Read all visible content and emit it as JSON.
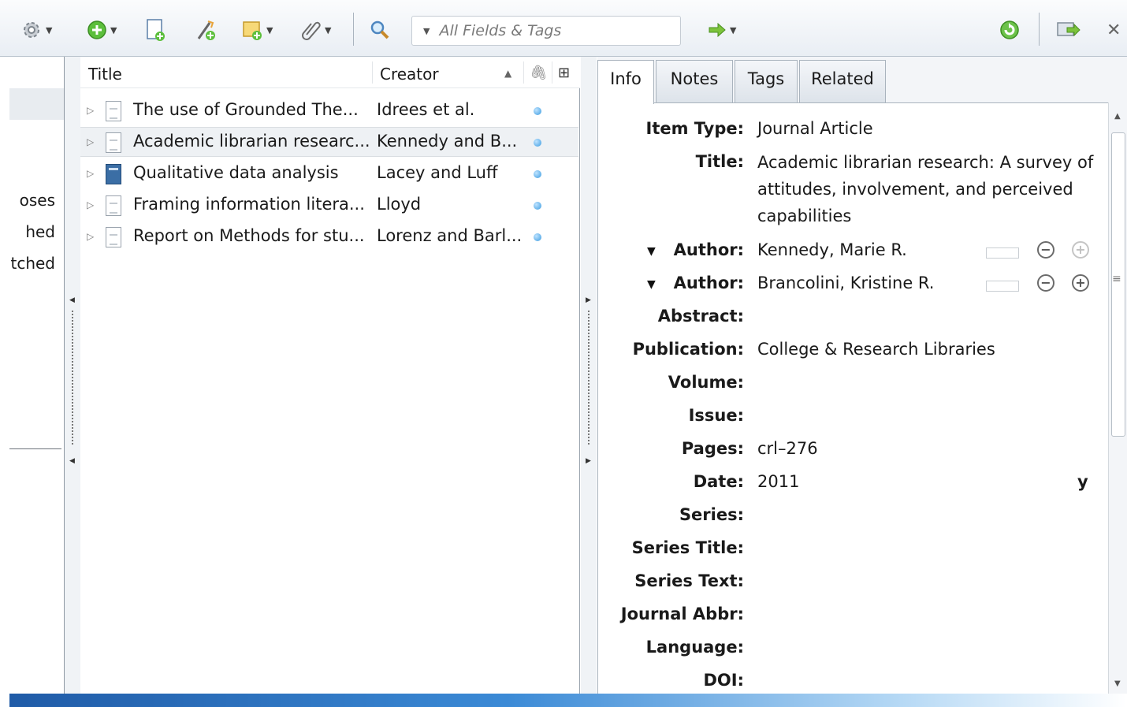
{
  "toolbar": {
    "search_placeholder": "All Fields & Tags",
    "icons": [
      "gear-icon",
      "new-item-icon",
      "new-item-from-file-icon",
      "add-by-identifier-icon",
      "new-note-icon",
      "attachment-icon",
      "search-icon",
      "locate-icon",
      "sync-icon",
      "fullscreen-icon",
      "close-icon"
    ]
  },
  "collections": {
    "items": [
      "oses",
      "hed",
      "tched"
    ]
  },
  "items_table": {
    "columns": {
      "title": "Title",
      "creator": "Creator"
    },
    "rows": [
      {
        "title": "The use of Grounded The...",
        "creator": "Idrees et al.",
        "icon": "document-icon"
      },
      {
        "title": "Academic librarian researc...",
        "creator": "Kennedy and B...",
        "icon": "document-icon",
        "selected": true
      },
      {
        "title": "Qualitative data analysis",
        "creator": "Lacey and Luff",
        "icon": "book-icon"
      },
      {
        "title": "Framing information litera...",
        "creator": "Lloyd",
        "icon": "document-icon"
      },
      {
        "title": "Report on Methods for stu...",
        "creator": "Lorenz and Barl...",
        "icon": "document-icon"
      }
    ]
  },
  "tabs": [
    "Info",
    "Notes",
    "Tags",
    "Related"
  ],
  "info": {
    "item_type_label": "Item Type:",
    "item_type": "Journal Article",
    "title_label": "Title:",
    "title": "Academic librarian research: A survey of attitudes, involvement, and perceived capabilities",
    "author_label": "Author:",
    "author1": "Kennedy,  Marie R.",
    "author2": "Brancolini,  Kristine R.",
    "abstract_label": "Abstract:",
    "publication_label": "Publication:",
    "publication": "College & Research Libraries",
    "volume_label": "Volume:",
    "issue_label": "Issue:",
    "pages_label": "Pages:",
    "pages": "crl–276",
    "date_label": "Date:",
    "date": "2011",
    "date_suffix": "y",
    "series_label": "Series:",
    "series_title_label": "Series Title:",
    "series_text_label": "Series Text:",
    "journal_abbr_label": "Journal Abbr:",
    "language_label": "Language:",
    "doi_label": "DOI:"
  }
}
